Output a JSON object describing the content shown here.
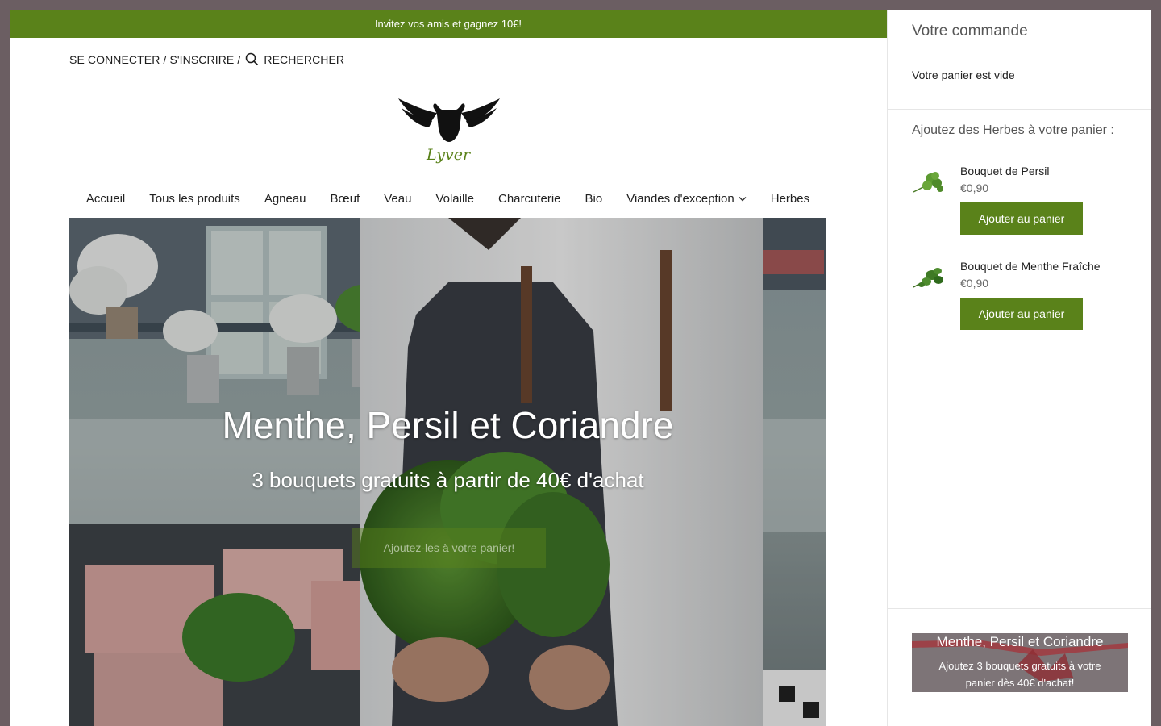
{
  "announcement": "Invitez vos amis et gagnez 10€!",
  "account": {
    "login": "SE CONNECTER",
    "separator": "/",
    "register": "S'INSCRIRE",
    "search": "RECHERCHER"
  },
  "brand": {
    "logo_text": "Lyver"
  },
  "nav": {
    "items": [
      "Accueil",
      "Tous les produits",
      "Agneau",
      "Bœuf",
      "Veau",
      "Volaille",
      "Charcuterie",
      "Bio",
      "Viandes d'exception",
      "Herbes"
    ]
  },
  "hero": {
    "title": "Menthe, Persil et Coriandre",
    "subtitle": "3 bouquets gratuits à partir de 40€ d'achat",
    "button": "Ajoutez-les à votre panier!"
  },
  "cart": {
    "title": "Votre commande",
    "empty": "Votre panier est vide",
    "upsell_title": "Ajoutez des Herbes à votre panier :",
    "products": [
      {
        "name": "Bouquet de Persil",
        "price": "€0,90",
        "button": "Ajouter au panier",
        "icon": "parsley-icon"
      },
      {
        "name": "Bouquet de Menthe Fraîche",
        "price": "€0,90",
        "button": "Ajouter au panier",
        "icon": "mint-icon"
      }
    ],
    "promo": {
      "title": "Menthe, Persil et Coriandre",
      "text": "Ajoutez 3 bouquets gratuits à votre panier dès 40€ d'achat!"
    }
  },
  "colors": {
    "accent": "#5a821a",
    "frame": "#6b5e62"
  }
}
